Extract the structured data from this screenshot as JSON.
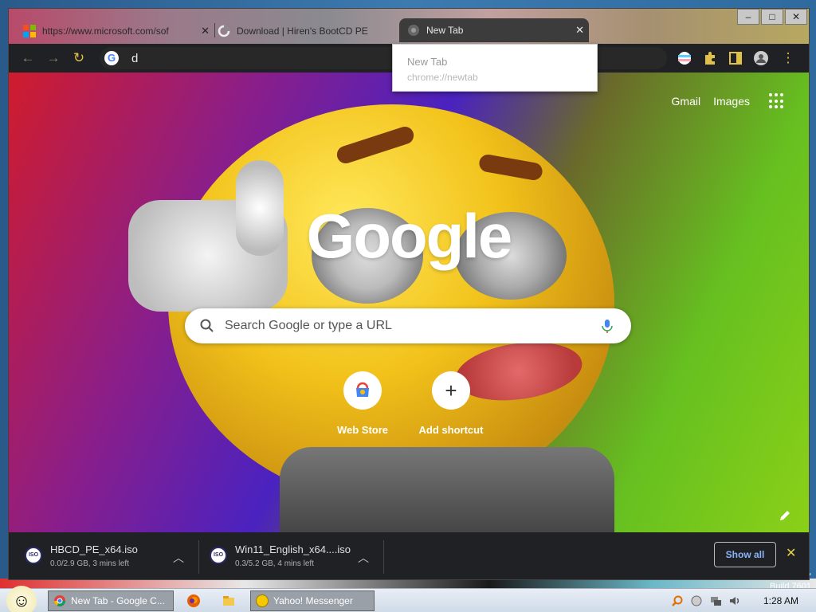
{
  "browser": {
    "tabs": [
      {
        "label": "https://www.microsoft.com/sof",
        "close": "✕"
      },
      {
        "label": "Download | Hiren's BootCD PE",
        "close": ""
      },
      {
        "label": "New Tab",
        "close": "✕"
      }
    ],
    "window_controls": {
      "minimize": "–",
      "maximize": "□",
      "close": "✕"
    },
    "omnibox": {
      "value": "d"
    },
    "dropdown": {
      "title": "New Tab",
      "url": "chrome://newtab"
    }
  },
  "newtab": {
    "top_links": {
      "gmail": "Gmail",
      "images": "Images"
    },
    "logo": "Google",
    "search_placeholder": "Search Google or type a URL",
    "shortcuts": [
      {
        "label": "Web Store"
      },
      {
        "label": "Add shortcut",
        "symbol": "+"
      }
    ]
  },
  "downloads": {
    "items": [
      {
        "filename": "HBCD_PE_x64.iso",
        "status": "0.0/2.9 GB, 3 mins left",
        "icon_text": "ISO"
      },
      {
        "filename": "Win11_English_x64....iso",
        "status": "0.3/5.2 GB, 4 mins left",
        "icon_text": "ISO"
      }
    ],
    "show_all": "Show all",
    "close": "✕"
  },
  "desktop": {
    "build_line1": "7",
    "build_line2": "Build 7601"
  },
  "taskbar": {
    "tasks": [
      {
        "label": "New Tab - Google C..."
      },
      {
        "label": "Yahoo! Messenger"
      }
    ],
    "clock": "1:28 AM"
  },
  "colors": {
    "accent": "#8ab4f8",
    "close_accent": "#e8d048",
    "tab_active_bg": "#3c3c3c"
  }
}
